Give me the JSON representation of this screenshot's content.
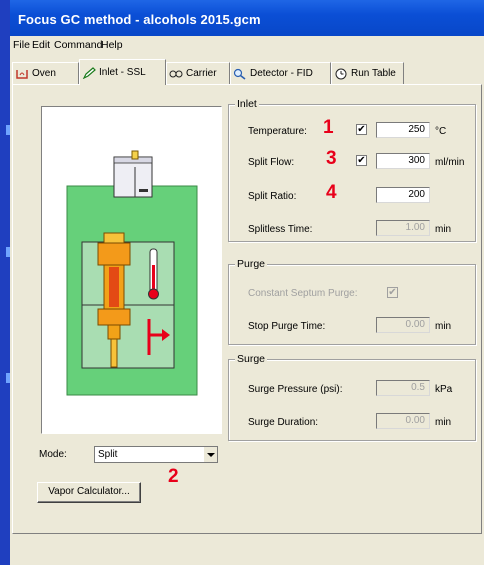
{
  "window": {
    "title": "Focus GC method - alcohols 2015.gcm"
  },
  "menu": [
    "File",
    "Edit",
    "Command",
    "Help"
  ],
  "tabs": [
    {
      "label": "Oven",
      "icon": "oven-icon"
    },
    {
      "label": "Inlet - SSL",
      "icon": "pen-icon",
      "active": true
    },
    {
      "label": "Carrier",
      "icon": "carrier-icon"
    },
    {
      "label": "Detector - FID",
      "icon": "magnifier-icon"
    },
    {
      "label": "Run Table",
      "icon": "clock-icon"
    }
  ],
  "inlet": {
    "caption": "Inlet",
    "temperature": {
      "label": "Temperature:",
      "checked": true,
      "value": "250",
      "unit": "°C"
    },
    "split_flow": {
      "label": "Split Flow:",
      "checked": true,
      "value": "300",
      "unit": "ml/min"
    },
    "split_ratio": {
      "label": "Split Ratio:",
      "value": "200"
    },
    "splitless_time": {
      "label": "Splitless Time:",
      "value": "1.00",
      "unit": "min"
    }
  },
  "purge": {
    "caption": "Purge",
    "constant_septum": {
      "label": "Constant Septum Purge:",
      "checked": true
    },
    "stop_purge_time": {
      "label": "Stop Purge Time:",
      "value": "0.00",
      "unit": "min"
    }
  },
  "surge": {
    "caption": "Surge",
    "pressure": {
      "label": "Surge Pressure (psi):",
      "value": "0.5",
      "unit": "kPa"
    },
    "duration": {
      "label": "Surge Duration:",
      "value": "0.00",
      "unit": "min"
    }
  },
  "mode": {
    "label": "Mode:",
    "value": "Split"
  },
  "vapor_button": "Vapor Calculator...",
  "annotations": [
    "1",
    "2",
    "3",
    "4"
  ],
  "colors": {
    "annotation": "#e8001a",
    "title_bar": "#0b4fd6",
    "schematic_green": "#66d07a"
  }
}
